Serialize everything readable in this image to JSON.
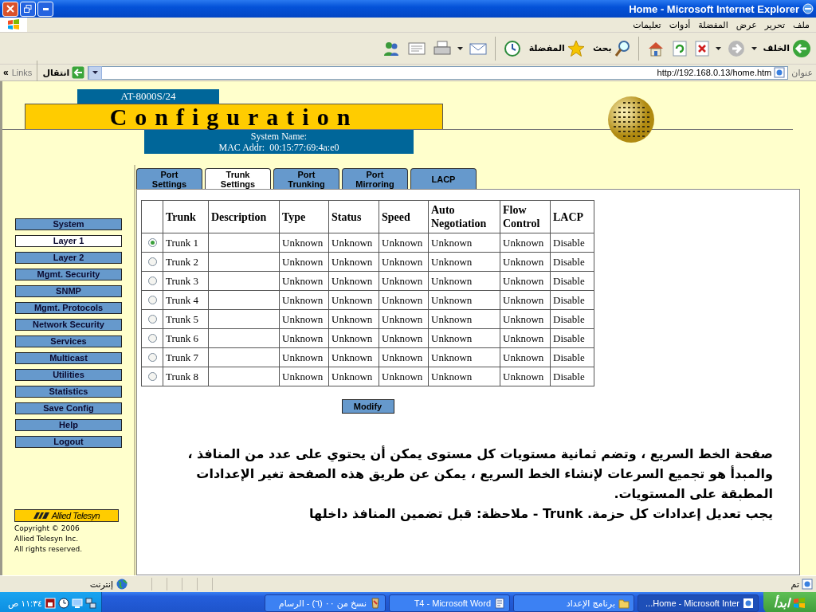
{
  "window": {
    "title": "Home - Microsoft Internet Explorer"
  },
  "menu": [
    "ملف",
    "تحرير",
    "عرض",
    "المفضلة",
    "أدوات",
    "تعليمات"
  ],
  "toolbar": {
    "back": "الخلف",
    "search": "بحث",
    "favorites": "المفضلة"
  },
  "address_bar": {
    "label": "عنوان",
    "value": "http://192.168.0.13/home.htm",
    "go": "انتقال",
    "links": "Links",
    "more": "»"
  },
  "header": {
    "model": "AT-8000S/24",
    "title": "Configuration",
    "system_name": "System Name:",
    "mac": "MAC Addr:  00:15:77:69:4a:e0"
  },
  "sidebar": {
    "items": [
      {
        "label": "System",
        "selected": false
      },
      {
        "label": "Layer 1",
        "selected": true
      },
      {
        "label": "Layer 2",
        "selected": false
      },
      {
        "label": "Mgmt. Security",
        "selected": false
      },
      {
        "label": "SNMP",
        "selected": false
      },
      {
        "label": "Mgmt. Protocols",
        "selected": false
      },
      {
        "label": "Network Security",
        "selected": false
      },
      {
        "label": "Services",
        "selected": false
      },
      {
        "label": "Multicast",
        "selected": false
      },
      {
        "label": "Utilities",
        "selected": false
      },
      {
        "label": "Statistics",
        "selected": false
      },
      {
        "label": "Save Config",
        "selected": false
      },
      {
        "label": "Help",
        "selected": false
      },
      {
        "label": "Logout",
        "selected": false
      }
    ]
  },
  "logo": {
    "text": "Allied Telesyn",
    "copyright": [
      "Copyright © 2006",
      "Allied Telesyn Inc.",
      "All rights reserved."
    ]
  },
  "tabs": [
    {
      "label": "Port\nSettings",
      "selected": false
    },
    {
      "label": "Trunk\nSettings",
      "selected": true
    },
    {
      "label": "Port\nTrunking",
      "selected": false
    },
    {
      "label": "Port\nMirroring",
      "selected": false
    },
    {
      "label": "LACP",
      "selected": false
    }
  ],
  "table": {
    "columns": [
      "Trunk",
      "Description",
      "Type",
      "Status",
      "Speed",
      "Auto Negotiation",
      "Flow Control",
      "LACP"
    ],
    "rows": [
      {
        "selected": true,
        "trunk": "Trunk  1",
        "type": "Unknown",
        "status": "Unknown",
        "speed": "Unknown",
        "auto_negotiation": "Unknown",
        "flow_control": "Unknown",
        "lacp": "Disable"
      },
      {
        "selected": false,
        "trunk": "Trunk  2",
        "type": "Unknown",
        "status": "Unknown",
        "speed": "Unknown",
        "auto_negotiation": "Unknown",
        "flow_control": "Unknown",
        "lacp": "Disable"
      },
      {
        "selected": false,
        "trunk": "Trunk  3",
        "type": "Unknown",
        "status": "Unknown",
        "speed": "Unknown",
        "auto_negotiation": "Unknown",
        "flow_control": "Unknown",
        "lacp": "Disable"
      },
      {
        "selected": false,
        "trunk": "Trunk  4",
        "type": "Unknown",
        "status": "Unknown",
        "speed": "Unknown",
        "auto_negotiation": "Unknown",
        "flow_control": "Unknown",
        "lacp": "Disable"
      },
      {
        "selected": false,
        "trunk": "Trunk  5",
        "type": "Unknown",
        "status": "Unknown",
        "speed": "Unknown",
        "auto_negotiation": "Unknown",
        "flow_control": "Unknown",
        "lacp": "Disable"
      },
      {
        "selected": false,
        "trunk": "Trunk  6",
        "type": "Unknown",
        "status": "Unknown",
        "speed": "Unknown",
        "auto_negotiation": "Unknown",
        "flow_control": "Unknown",
        "lacp": "Disable"
      },
      {
        "selected": false,
        "trunk": "Trunk  7",
        "type": "Unknown",
        "status": "Unknown",
        "speed": "Unknown",
        "auto_negotiation": "Unknown",
        "flow_control": "Unknown",
        "lacp": "Disable"
      },
      {
        "selected": false,
        "trunk": "Trunk  8",
        "type": "Unknown",
        "status": "Unknown",
        "speed": "Unknown",
        "auto_negotiation": "Unknown",
        "flow_control": "Unknown",
        "lacp": "Disable"
      }
    ]
  },
  "modify_button": "Modify",
  "note": [
    "صفحة الخط السريع ، وتضم ثمانية مستويات كل مستوى يمكن أن يحتوي على عدد من المنافذ ، والمبدأ هو تجميع السرعات لإنشاء الخط السريع ، يمكن عن طريق هذه الصفحة تغير الإعدادات المطبقة على المستويات.",
    "يجب تعديل إعدادات كل حزمة.  Trunk - ملاحظة: قبل تضمين المنافذ داخلها"
  ],
  "status_bar": {
    "text": "تم",
    "zone": "إنترنت"
  },
  "taskbar": {
    "start": "ابدأ",
    "tasks": [
      {
        "label": "نسخ من ٠٠ (٦) - الرسام",
        "selected": false
      },
      {
        "label": "T4 - Microsoft Word",
        "selected": false
      },
      {
        "label": "برنامج الإعداد",
        "selected": false
      },
      {
        "label": "Home - Microsoft Inter...",
        "selected": true
      }
    ],
    "clock": "١١:٣٤ ص"
  }
}
